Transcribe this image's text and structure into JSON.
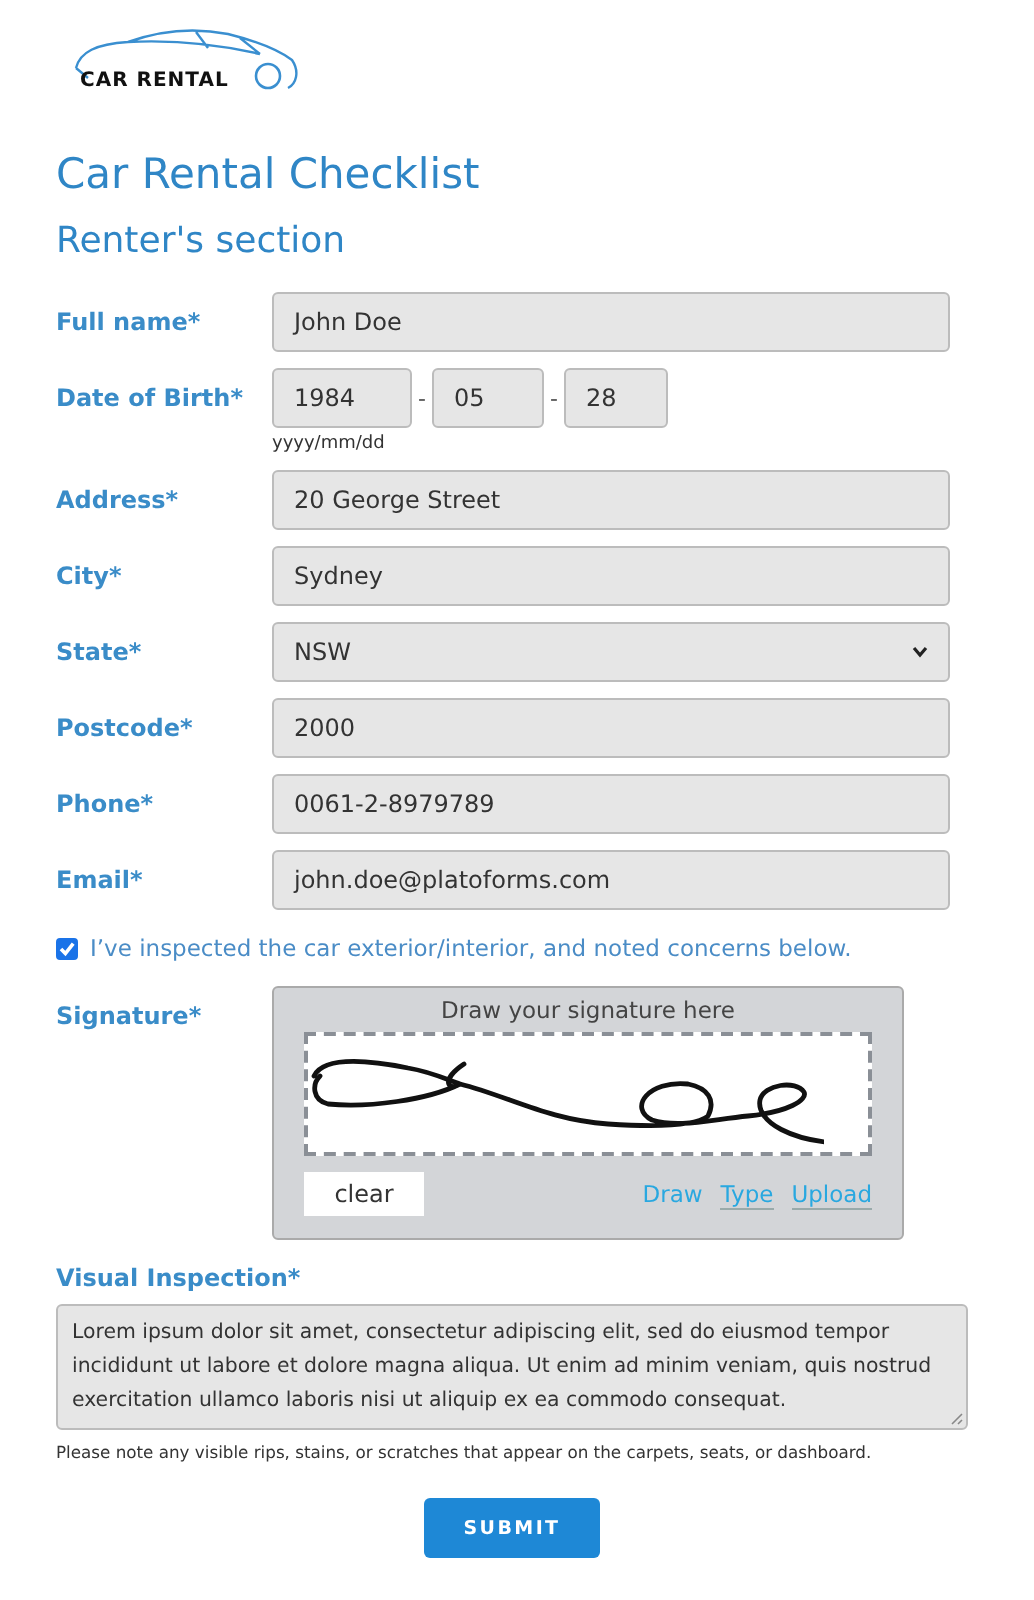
{
  "logo": {
    "text": "CAR RENTAL"
  },
  "title": "Car Rental Checklist",
  "section": "Renter's section",
  "fields": [
    {
      "kind": "text",
      "label": "Full name*",
      "value": "John Doe"
    },
    {
      "kind": "date",
      "label": "Date of Birth*",
      "parts": [
        "1984",
        "05",
        "28"
      ],
      "separators": [
        "-",
        "-"
      ],
      "hint": "yyyy/mm/dd"
    },
    {
      "kind": "text",
      "label": "Address*",
      "value": "20 George Street"
    },
    {
      "kind": "text",
      "label": "City*",
      "value": "Sydney"
    },
    {
      "kind": "select",
      "label": "State*",
      "value": "NSW"
    },
    {
      "kind": "text",
      "label": "Postcode*",
      "value": "2000"
    },
    {
      "kind": "text",
      "label": "Phone*",
      "value": "0061-2-8979789"
    },
    {
      "kind": "text",
      "label": "Email*",
      "value": "john.doe@platoforms.com"
    }
  ],
  "agreement": {
    "checked": true,
    "label": "I’ve inspected the car exterior/interior, and noted concerns below."
  },
  "signature": {
    "label": "Signature*",
    "prompt": "Draw your signature here",
    "clear": "clear",
    "modes": [
      {
        "label": "Draw",
        "selected": true
      },
      {
        "label": "Type",
        "selected": false
      },
      {
        "label": "Upload",
        "selected": false
      }
    ]
  },
  "inspection": {
    "label": "Visual Inspection*",
    "value": "Lorem ipsum dolor sit amet, consectetur adipiscing elit, sed do eiusmod tempor incididunt ut labore et dolore magna aliqua. Ut enim ad minim veniam, quis nostrud exercitation ullamco laboris nisi ut aliquip ex ea commodo consequat.",
    "note": "Please note any visible rips, stains, or scratches that appear on the carpets, seats, or dashboard."
  },
  "submit": "SUBMIT"
}
